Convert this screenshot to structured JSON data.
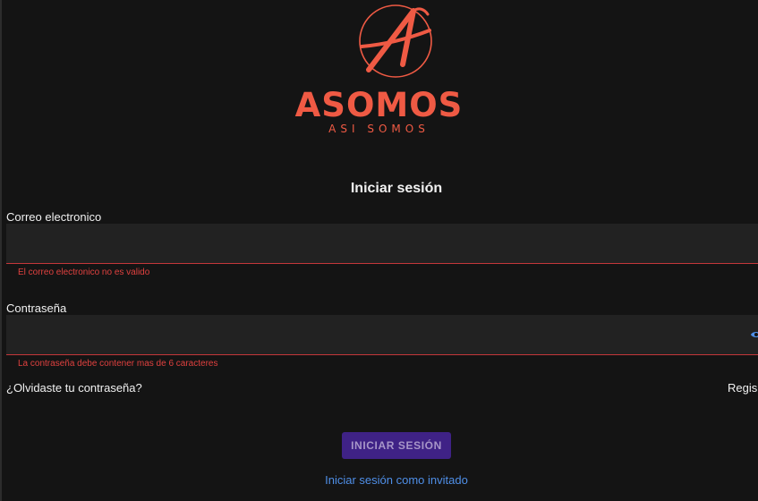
{
  "brand": {
    "name": "ASOMOS",
    "tagline": "ASI SOMOS",
    "logo_icon": "circled-letter-a-logo",
    "color": "#ef5a44"
  },
  "login": {
    "title": "Iniciar sesión",
    "email": {
      "label": "Correo electronico",
      "value": "",
      "error": "El correo electronico no es valido"
    },
    "password": {
      "label": "Contraseña",
      "value": "",
      "error": "La contraseña debe contener mas de 6 caracteres",
      "toggle_icon": "eye-icon"
    },
    "forgot_label": "¿Olvidaste tu contraseña?",
    "register_label": "Regis",
    "submit_label": "INICIAR SESIÓN",
    "guest_label": "Iniciar sesión como invitado"
  },
  "colors": {
    "background": "#141414",
    "input_bg": "#222222",
    "error": "#e0413f",
    "button_bg": "#3f2286",
    "button_text": "#a796c8",
    "link": "#4f8fe8"
  }
}
